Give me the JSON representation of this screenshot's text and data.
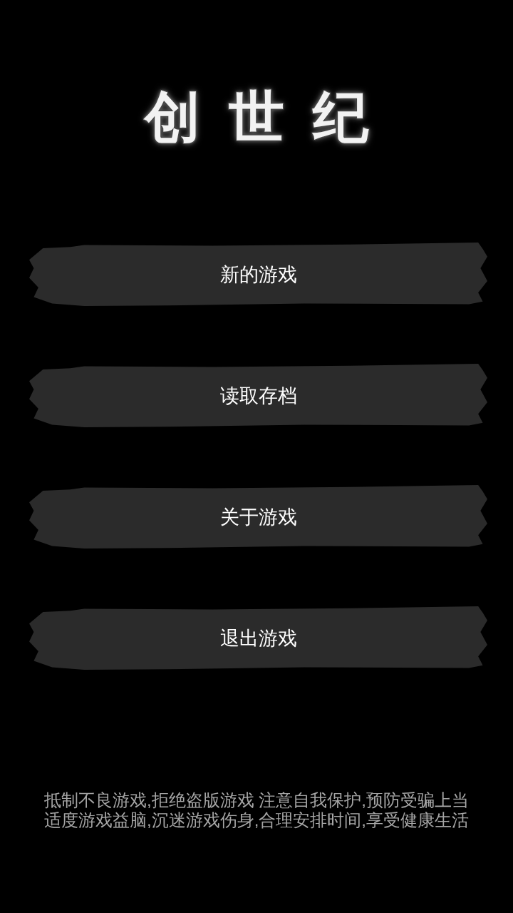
{
  "title": "创世纪",
  "menu": [
    {
      "label": "新的游戏"
    },
    {
      "label": "读取存档"
    },
    {
      "label": "关于游戏"
    },
    {
      "label": "退出游戏"
    }
  ],
  "notice": [
    "抵制不良游戏,拒绝盗版游戏 注意自我保护,预防受骗上当",
    "适度游戏益脑,沉迷游戏伤身,合理安排时间,享受健康生活"
  ]
}
